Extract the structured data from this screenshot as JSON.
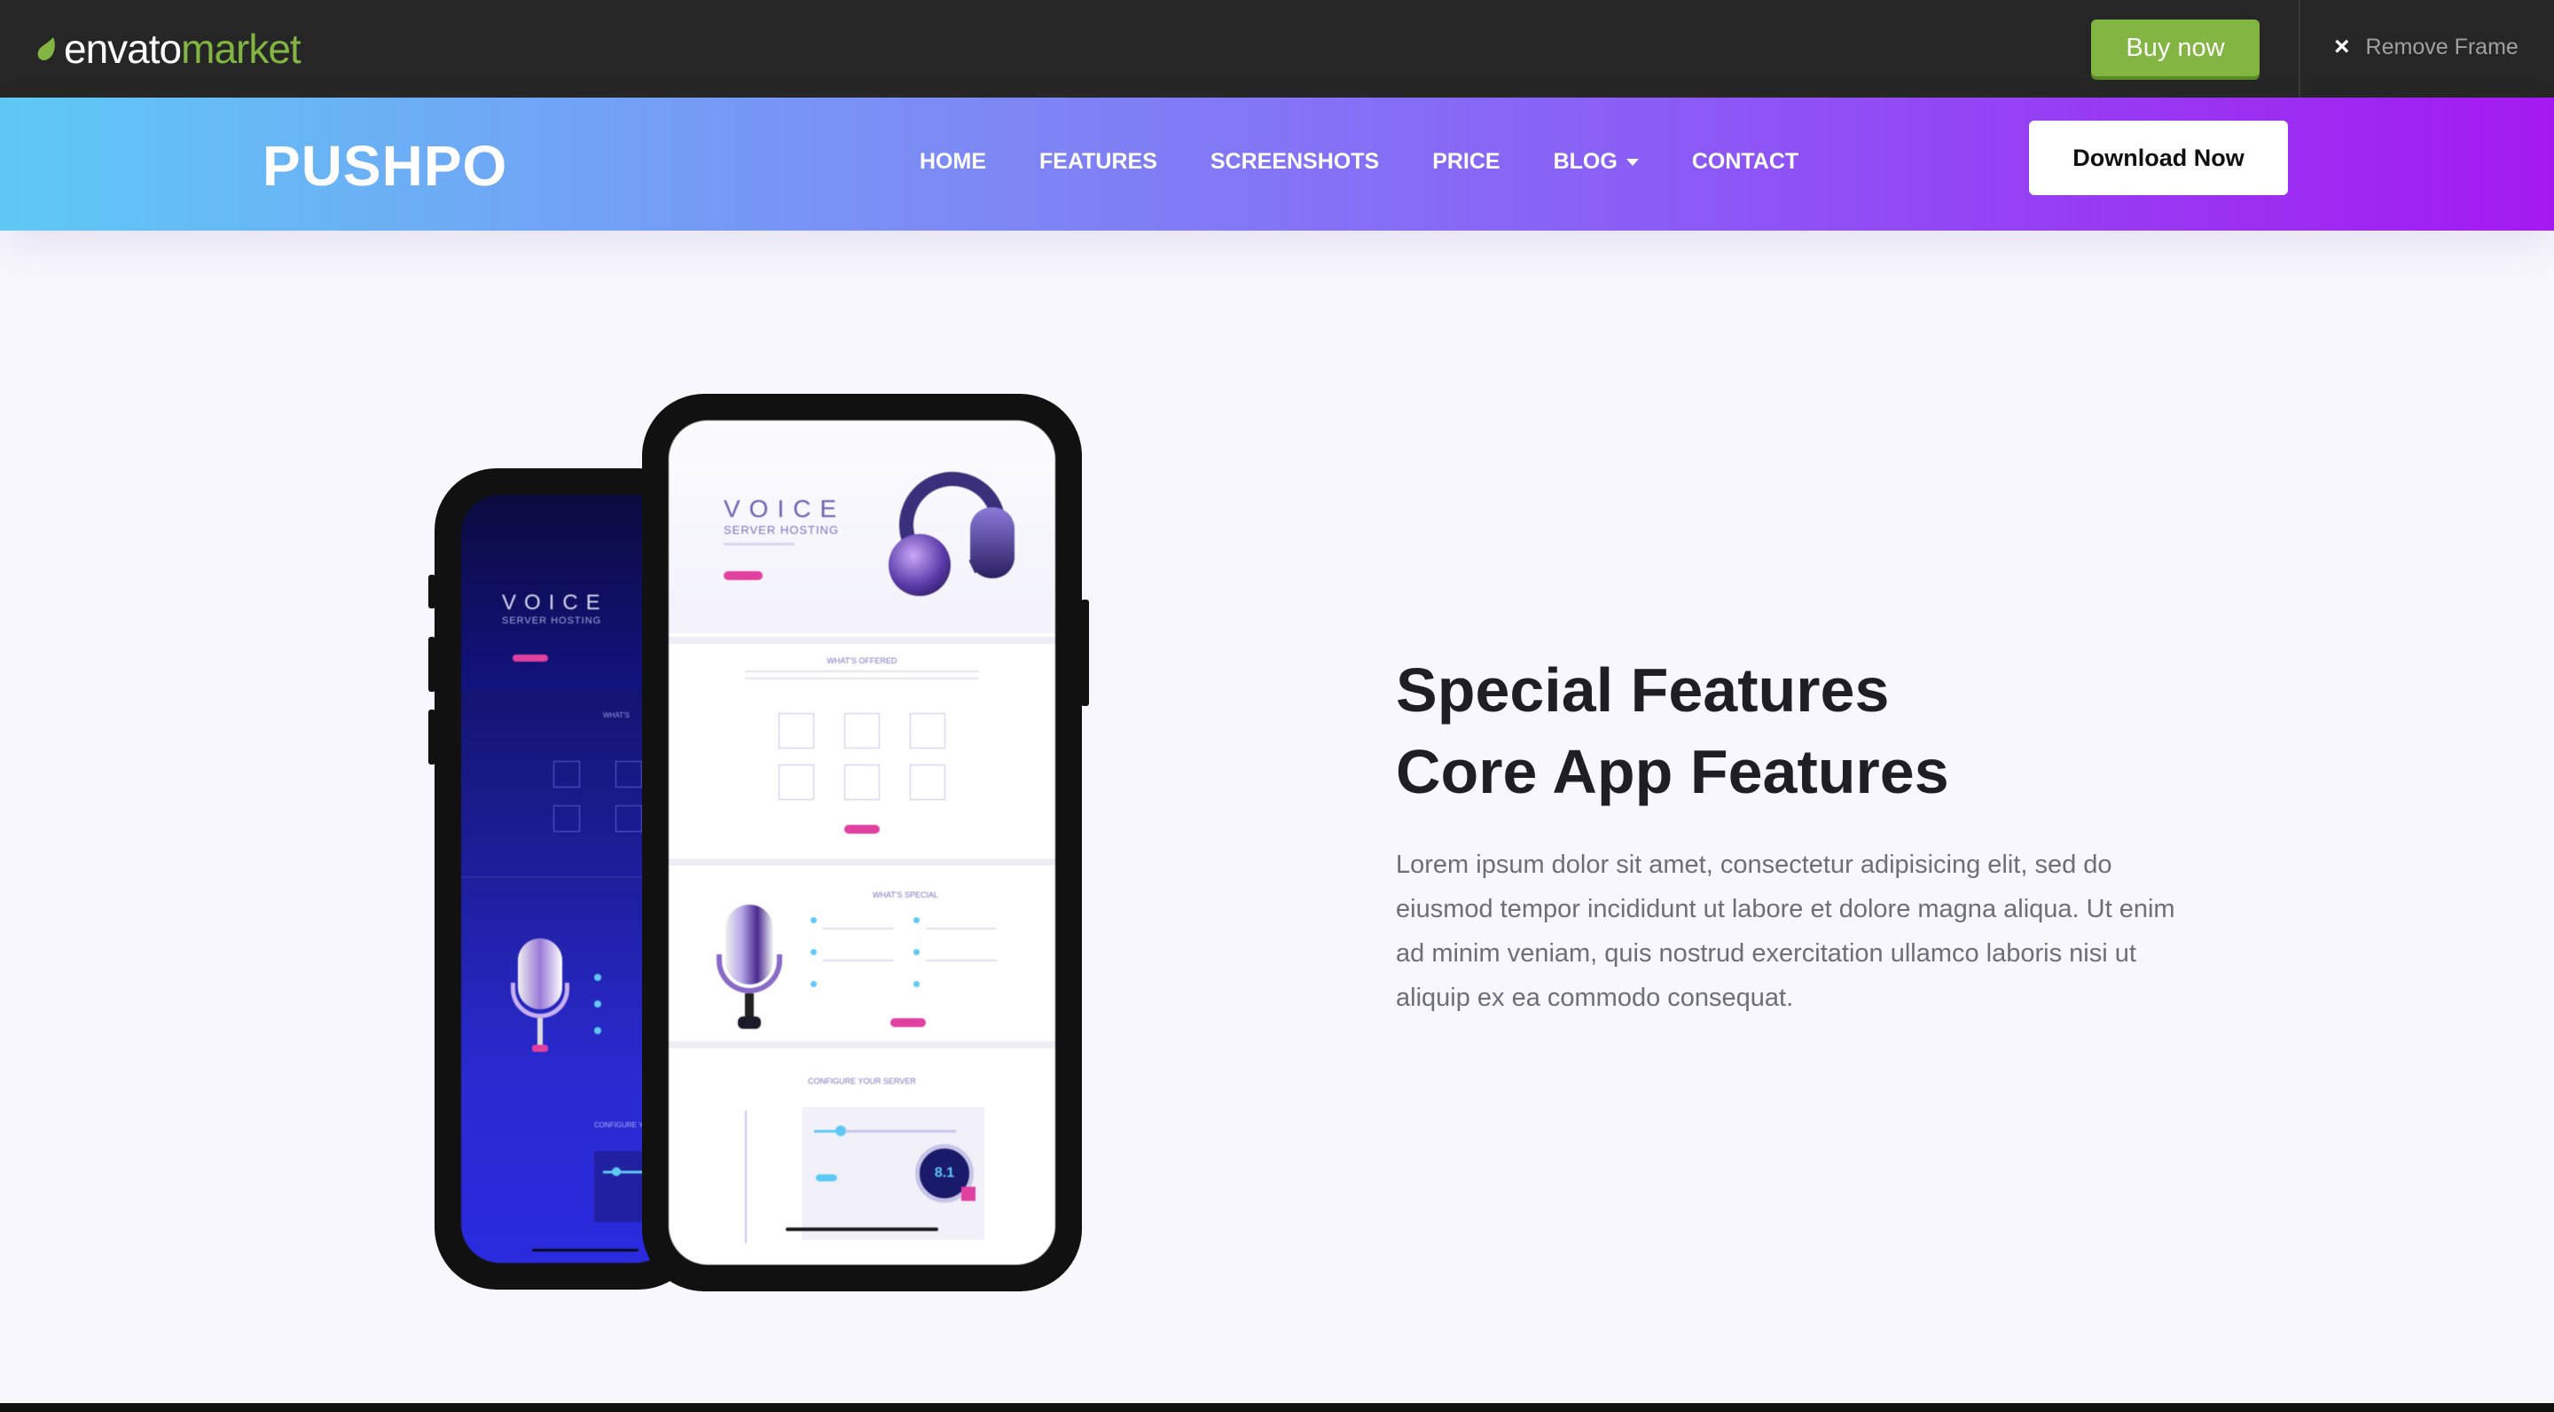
{
  "envato": {
    "logo_part1": "envato",
    "logo_part2": "market",
    "buy_label": "Buy now",
    "remove_label": "Remove Frame",
    "close_icon": "×"
  },
  "nav": {
    "brand": "PUSHPO",
    "items": [
      {
        "label": "HOME"
      },
      {
        "label": "FEATURES"
      },
      {
        "label": "SCREENSHOTS"
      },
      {
        "label": "PRICE"
      },
      {
        "label": "BLOG",
        "has_dropdown": true
      },
      {
        "label": "CONTACT"
      }
    ],
    "cta": "Download Now"
  },
  "features": {
    "title_line1": "Special Features",
    "title_line2": "Core App Features",
    "description": "Lorem ipsum dolor sit amet, consectetur adipisicing elit, sed do eiusmod tempor incididunt ut labore et dolore magna aliqua. Ut enim ad minim veniam, quis nostrud exercitation ullamco laboris nisi ut aliquip ex ea commodo consequat."
  },
  "phone_front": {
    "hero_title": "VOICE",
    "hero_subtitle": "SERVER HOSTING",
    "section1": "WHAT'S OFFERED",
    "section2": "WHAT'S SPECIAL",
    "section3": "CONFIGURE YOUR SERVER",
    "gauge_value": "8.1"
  },
  "phone_back": {
    "hero_title": "VOICE",
    "hero_subtitle": "SERVER HOSTING",
    "section1": "WHAT'S",
    "section3": "CONFIGURE Y"
  },
  "colors": {
    "envato_green": "#82b541",
    "nav_gradient_start": "#5fc9f5",
    "nav_gradient_end": "#a419f0",
    "accent_pink": "#e040a0"
  }
}
